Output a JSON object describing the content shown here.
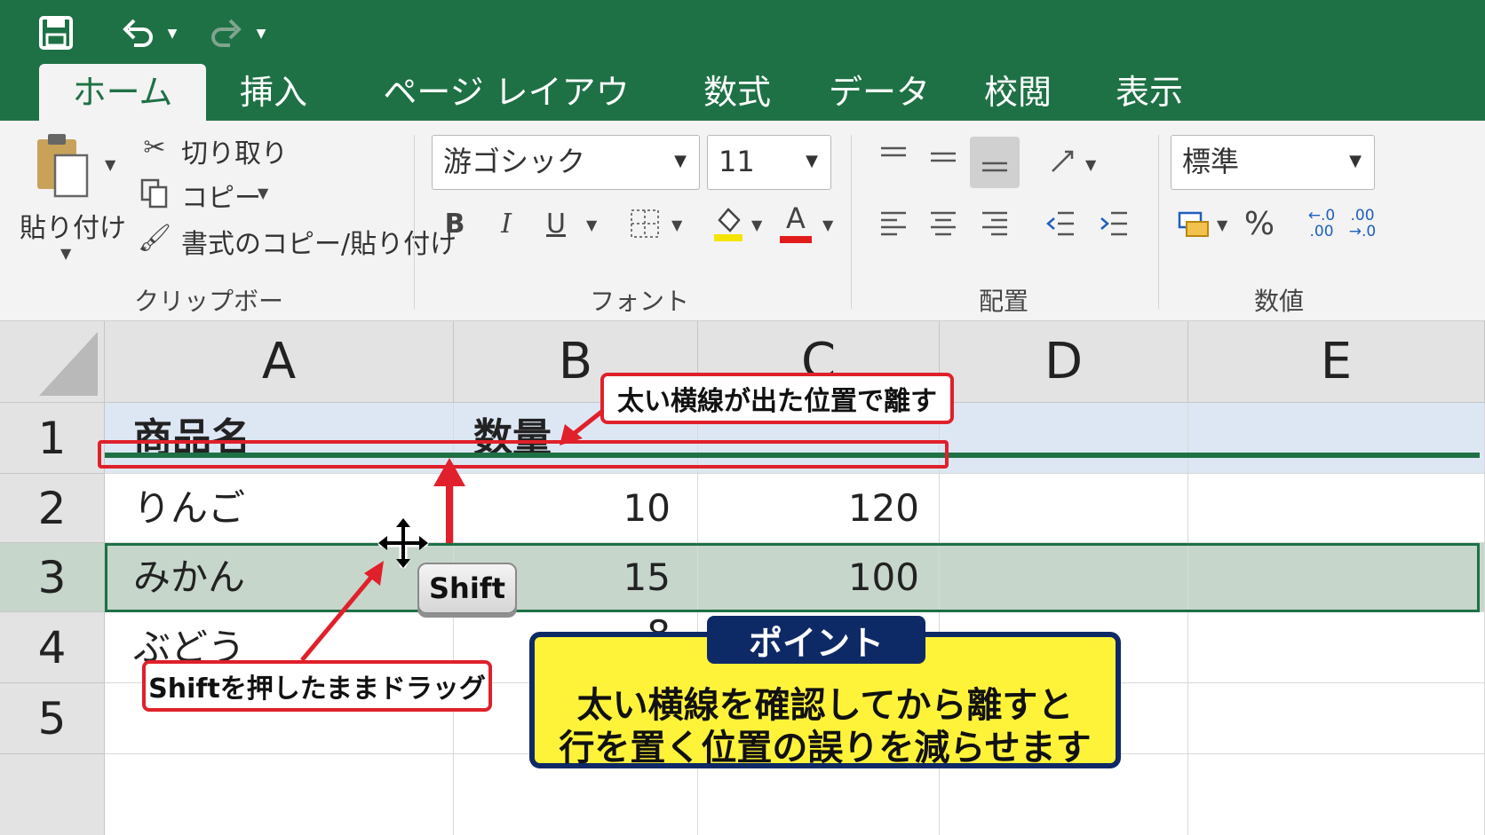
{
  "quick_access": {
    "save_icon": "save-icon",
    "undo_icon": "undo-icon",
    "redo_icon": "redo-icon"
  },
  "tabs": [
    {
      "label": "ホーム",
      "active": true
    },
    {
      "label": "挿入"
    },
    {
      "label": "ページ レイアウト"
    },
    {
      "label": "数式"
    },
    {
      "label": "データ"
    },
    {
      "label": "校閲"
    },
    {
      "label": "表示"
    }
  ],
  "ribbon": {
    "clipboard": {
      "paste_label": "貼り付け",
      "cut_label": "切り取り",
      "copy_label": "コピー",
      "format_painter_label": "書式のコピー/貼り付け",
      "group_label": "クリップボード"
    },
    "font": {
      "font_name": "游ゴシック",
      "font_size": "11",
      "bold": "B",
      "italic": "I",
      "underline": "U",
      "font_color_letter": "A",
      "group_label": "フォント"
    },
    "alignment": {
      "group_label": "配置"
    },
    "number": {
      "format": "標準",
      "percent": "%",
      "inc_decimal": "←.0\n.00",
      "dec_decimal": ".00\n→.0",
      "group_label": "数値"
    }
  },
  "sheet": {
    "columns": [
      "A",
      "B",
      "C",
      "D",
      "E"
    ],
    "rows": [
      "1",
      "2",
      "3",
      "4",
      "5"
    ],
    "cells": {
      "A1": "商品名",
      "B1": "数量",
      "A2": "りんご",
      "B2": "10",
      "C2": "120",
      "A3": "みかん",
      "B3": "15",
      "C3": "100",
      "A4": "ぶどう",
      "B4": "8"
    }
  },
  "annotations": {
    "release_callout": "太い横線が出た位置で離す",
    "shift_key": "Shift",
    "drag_callout": "Shiftを押したままドラッグ",
    "point_title": "ポイント",
    "point_line1": "太い横線を確認してから離すと",
    "point_line2": "行を置く位置の誤りを減らせます"
  },
  "colors": {
    "excel_green": "#1e7145",
    "callout_red": "#e0202a",
    "point_yellow": "#fff33a",
    "point_navy": "#0e2a66"
  }
}
